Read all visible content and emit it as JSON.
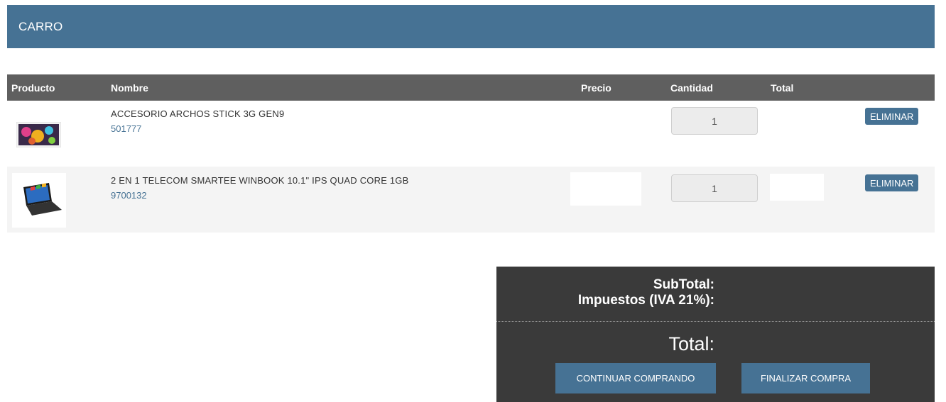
{
  "header": {
    "title": "CARRO"
  },
  "table": {
    "columns": [
      "Producto",
      "Nombre",
      "Precio",
      "Cantidad",
      "Total"
    ]
  },
  "rows": [
    {
      "name": "ACCESORIO ARCHOS STICK 3G GEN9",
      "sku": "501777",
      "quantity": "1",
      "remove_label": "ELIMINAR"
    },
    {
      "name": "2 EN 1 TELECOM SMARTEE WINBOOK 10.1\" IPS QUAD CORE 1GB",
      "sku": "9700132",
      "quantity": "1",
      "remove_label": "ELIMINAR"
    }
  ],
  "summary": {
    "subtotal_label": "SubTotal:",
    "tax_label": "Impuestos (IVA 21%):",
    "total_label": "Total:",
    "continue_label": "CONTINUAR COMPRANDO",
    "checkout_label": "FINALIZAR COMPRA"
  },
  "colors": {
    "accent": "#467294",
    "table_header": "#5f5f5f",
    "summary_bg": "#3a3a3a"
  }
}
